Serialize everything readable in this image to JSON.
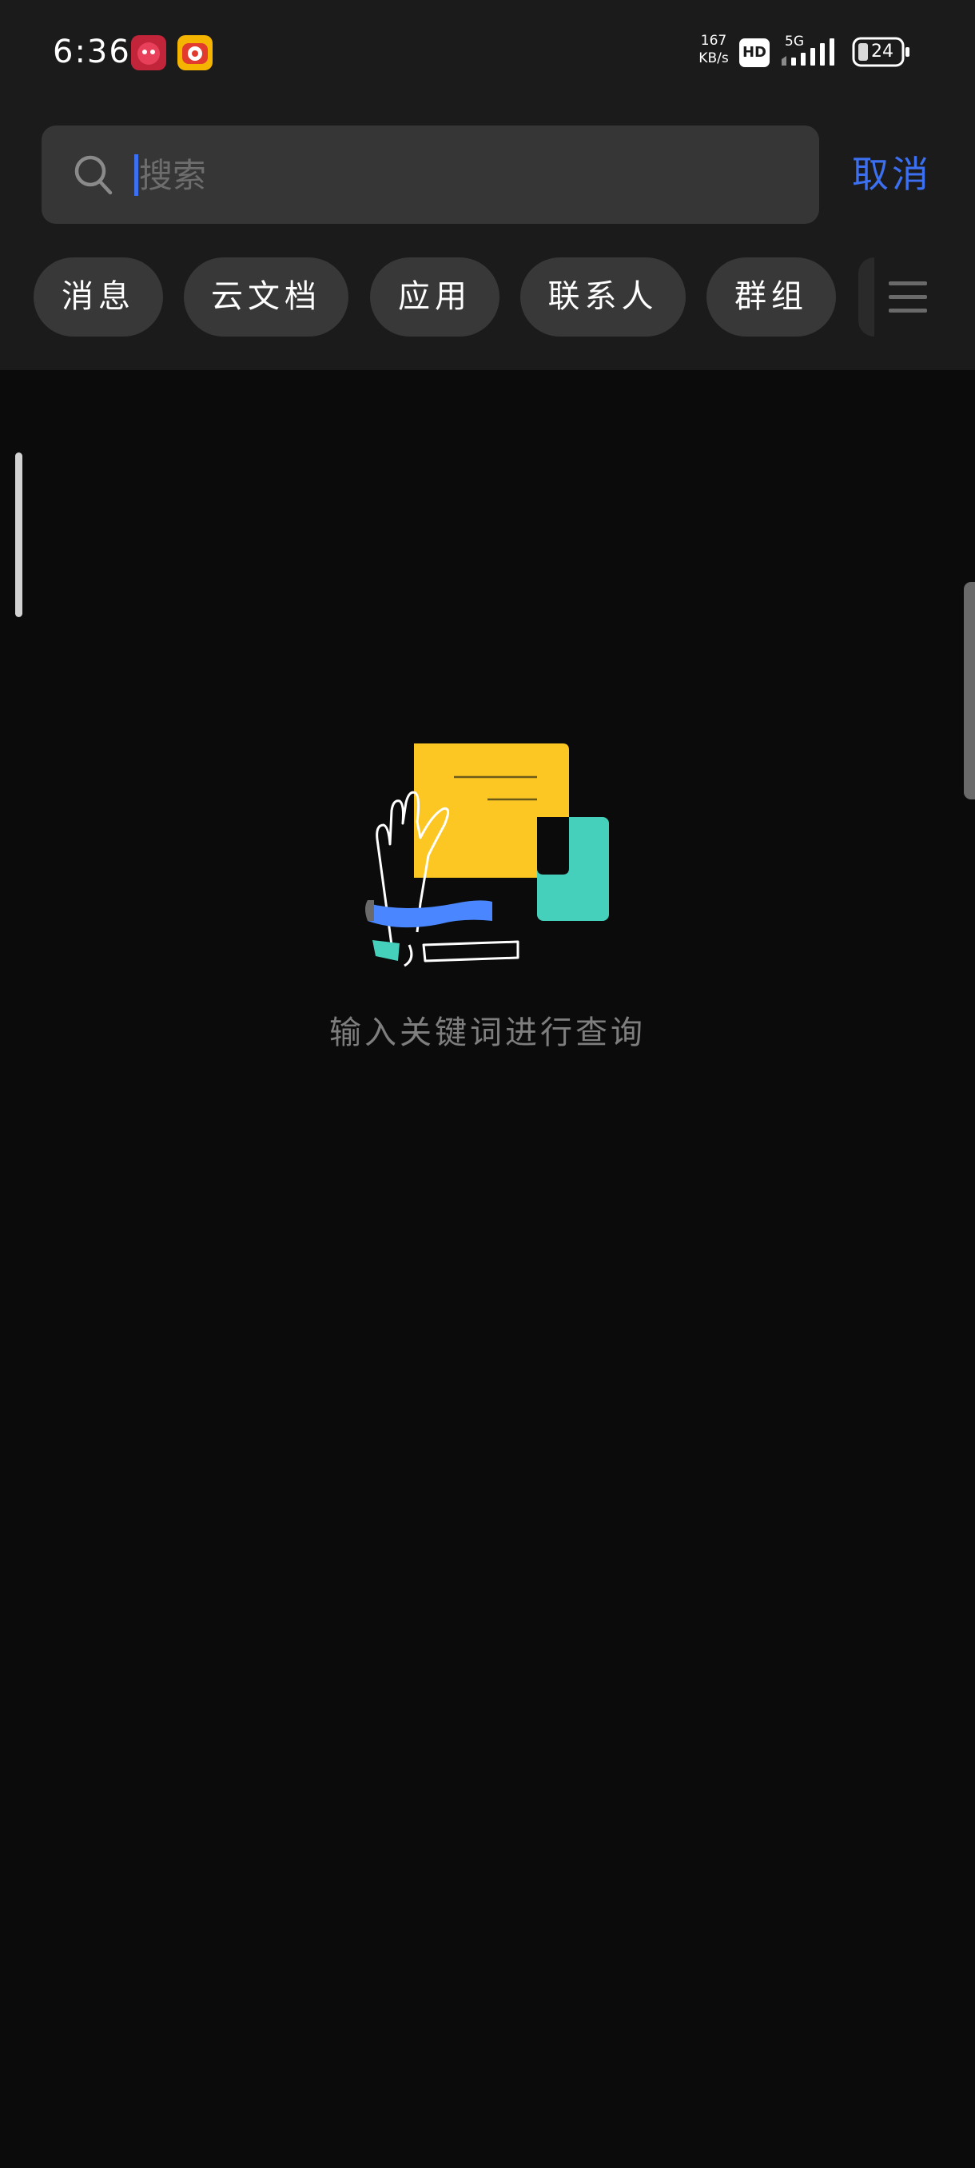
{
  "status_bar": {
    "time": "6:36",
    "net_speed_value": "167",
    "net_speed_unit": "KB/s",
    "hd_label": "HD",
    "network": "5G",
    "battery": "24"
  },
  "search": {
    "placeholder": "搜索",
    "value": "",
    "cancel_label": "取消"
  },
  "chips": [
    "消息",
    "云文档",
    "应用",
    "联系人",
    "群组"
  ],
  "empty_state": {
    "text": "输入关键词进行查询"
  },
  "colors": {
    "accent": "#3c70f0",
    "background": "#0b0b0b",
    "header_background": "#1b1b1b",
    "chip_background": "#383838",
    "illustration_yellow": "#fcc723",
    "illustration_teal": "#45d0bb",
    "illustration_blue": "#4a86ff"
  },
  "icons": {
    "search": "search-icon",
    "menu": "menu-icon",
    "signal": "signal-icon",
    "battery": "battery-icon"
  }
}
